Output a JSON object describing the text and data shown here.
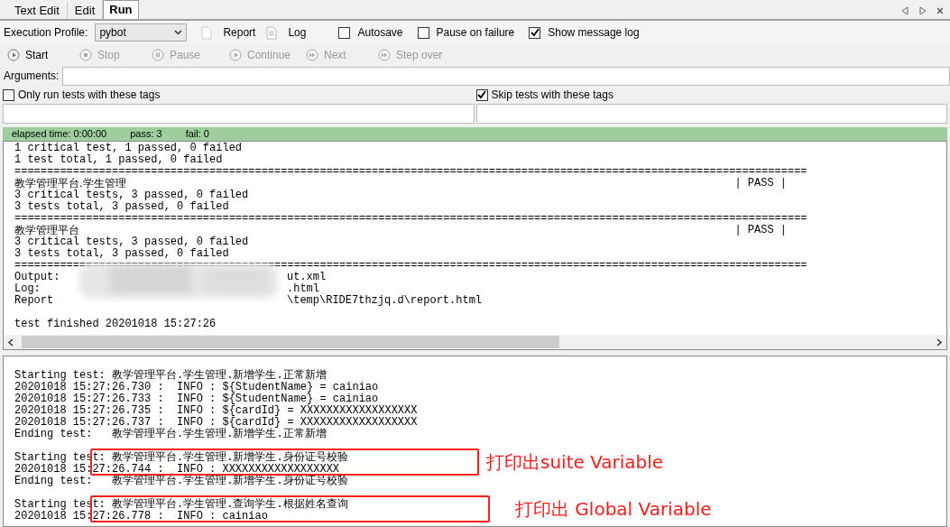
{
  "tabs": [
    {
      "label": "Text Edit",
      "selected": false
    },
    {
      "label": "Edit",
      "selected": false
    },
    {
      "label": "Run",
      "selected": true
    }
  ],
  "toolbar": {
    "profile_label": "Execution Profile:",
    "profile_value": "pybot",
    "report": "Report",
    "log": "Log",
    "options": [
      {
        "label": "Autosave",
        "checked": false
      },
      {
        "label": "Pause on failure",
        "checked": false
      },
      {
        "label": "Show message log",
        "checked": true
      }
    ]
  },
  "run_buttons": [
    {
      "label": "Start",
      "disabled": false,
      "kind": "play"
    },
    {
      "label": "Stop",
      "disabled": true,
      "kind": "stop"
    },
    {
      "label": "Pause",
      "disabled": true,
      "kind": "pause"
    },
    {
      "label": "Continue",
      "disabled": true,
      "kind": "play"
    },
    {
      "label": "Next",
      "disabled": true,
      "kind": "next"
    },
    {
      "label": "Step over",
      "disabled": true,
      "kind": "next"
    }
  ],
  "arguments_label": "Arguments:",
  "tag_filters": [
    {
      "label": "Only run tests with these tags",
      "checked": false
    },
    {
      "label": "Skip tests with these tags",
      "checked": true
    }
  ],
  "status_bar": {
    "elapsed": "elapsed time: 0:00:00",
    "pass": "pass: 3",
    "fail": "fail: 0"
  },
  "output": [
    {
      "kind": "text",
      "text": "1 critical test, 1 passed, 0 failed"
    },
    {
      "kind": "text",
      "text": "1 test total, 1 passed, 0 failed"
    },
    {
      "kind": "rule",
      "text": "=========================================================================================================================="
    },
    {
      "kind": "suite",
      "text": "教学管理平台.学生管理",
      "status": "| PASS |"
    },
    {
      "kind": "text",
      "text": "3 critical tests, 3 passed, 0 failed"
    },
    {
      "kind": "text",
      "text": "3 tests total, 3 passed, 0 failed"
    },
    {
      "kind": "rule",
      "text": "=========================================================================================================================="
    },
    {
      "kind": "suite",
      "text": "教学管理平台",
      "status": "| PASS |"
    },
    {
      "kind": "text",
      "text": "3 critical tests, 3 passed, 0 failed"
    },
    {
      "kind": "text",
      "text": "3 tests total, 3 passed, 0 failed"
    },
    {
      "kind": "rule",
      "text": "=========================================================================================================================="
    },
    {
      "kind": "path",
      "text": "Output:",
      "tail": "ut.xml"
    },
    {
      "kind": "path",
      "text": "Log:",
      "tail": ".html"
    },
    {
      "kind": "path",
      "text": "Report",
      "tail": "\\temp\\RIDE7thzjq.d\\report.html"
    },
    {
      "kind": "blank"
    },
    {
      "kind": "text",
      "text": "test finished 20201018 15:27:26"
    }
  ],
  "message_log": [
    {
      "kind": "text",
      "text": "Starting test: 教学管理平台.学生管理.新增学生.正常新增"
    },
    {
      "kind": "text",
      "text": "20201018 15:27:26.730 :  INFO : ${StudentName} = cainiao"
    },
    {
      "kind": "text",
      "text": "20201018 15:27:26.733 :  INFO : ${StudentName} = cainiao"
    },
    {
      "kind": "text",
      "text": "20201018 15:27:26.735 :  INFO : ${cardId} = XXXXXXXXXXXXXXXXXX"
    },
    {
      "kind": "text",
      "text": "20201018 15:27:26.737 :  INFO : ${cardId} = XXXXXXXXXXXXXXXXXX"
    },
    {
      "kind": "text",
      "text": "Ending test:   教学管理平台.学生管理.新增学生.正常新增"
    },
    {
      "kind": "blank"
    },
    {
      "kind": "text",
      "text": "Starting test: 教学管理平台.学生管理.新增学生.身份证号校验"
    },
    {
      "kind": "text",
      "text": "20201018 15:27:26.744 :  INFO : XXXXXXXXXXXXXXXXXX"
    },
    {
      "kind": "text",
      "text": "Ending test:   教学管理平台.学生管理.新增学生.身份证号校验"
    },
    {
      "kind": "blank"
    },
    {
      "kind": "text",
      "text": "Starting test: 教学管理平台.学生管理.查询学生.根据姓名查询"
    },
    {
      "kind": "text",
      "text": "20201018 15:27:26.778 :  INFO : cainiao"
    }
  ],
  "annotations": [
    {
      "text": "打印出suite Variable"
    },
    {
      "text": "打印出 Global Variable"
    }
  ]
}
